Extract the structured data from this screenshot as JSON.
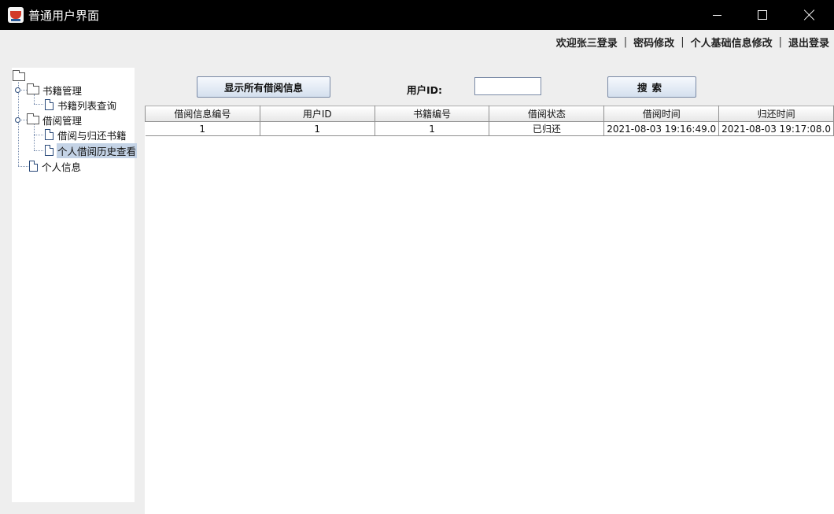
{
  "window": {
    "title": "普通用户界面"
  },
  "topnav": {
    "welcome": "欢迎张三登录",
    "change_password": "密码修改",
    "edit_profile": "个人基础信息修改",
    "logout": "退出登录",
    "separator": "|"
  },
  "tree": {
    "book_mgmt": "书籍管理",
    "book_list": "书籍列表查询",
    "borrow_mgmt": "借阅管理",
    "borrow_return": "借阅与归还书籍",
    "borrow_history": "个人借阅历史查看",
    "personal_info": "个人信息",
    "selected": "个人借阅历史查看"
  },
  "toolbar": {
    "show_all": "显示所有借阅信息",
    "userid_label": "用户ID:",
    "userid_value": "",
    "search": "搜索"
  },
  "table": {
    "columns": [
      "借阅信息编号",
      "用户ID",
      "书籍编号",
      "借阅状态",
      "借阅时间",
      "归还时间"
    ],
    "rows": [
      [
        "1",
        "1",
        "1",
        "已归还",
        "2021-08-03 19:16:49.0",
        "2021-08-03 19:17:08.0"
      ]
    ]
  }
}
